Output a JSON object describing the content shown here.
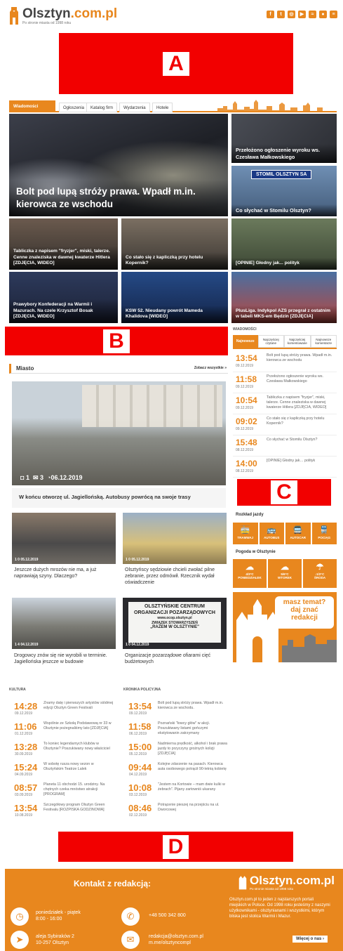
{
  "header": {
    "logo_main": "Olsztyn",
    "logo_domain": ".com.pl",
    "tagline": "Po stronie miasta od 1998 roku",
    "social": [
      {
        "icon": "facebook-icon",
        "glyph": "f"
      },
      {
        "icon": "twitter-icon",
        "glyph": "t"
      },
      {
        "icon": "instagram-icon",
        "glyph": "◎"
      },
      {
        "icon": "youtube-icon",
        "glyph": "▶"
      },
      {
        "icon": "rss-icon",
        "glyph": "≈"
      },
      {
        "icon": "user-icon",
        "glyph": "●"
      },
      {
        "icon": "menu-icon",
        "glyph": "≡"
      }
    ]
  },
  "ads": {
    "a": "A",
    "b": "B",
    "c": "C",
    "d": "D"
  },
  "nav": {
    "tabs": [
      "Wiadomości",
      "Ogłoszenia",
      "Katalog firm",
      "Wydarzenia",
      "Hotele"
    ]
  },
  "hero": {
    "main": "Bolt pod lupą stróży prawa. Wpadł m.in. kierowca ze wschodu",
    "side": [
      "Przełożono ogłoszenie wyroku ws. Czesława Małkowskiego",
      "Co słychać w Stomilu Olsztyn?"
    ],
    "sign": "STOMIL OLSZTYN SA",
    "row2": [
      "Tabliczka z napisem \"fryzjer\", miski, talerze. Cenne znaleziska w dawnej kwaterze Hitlera [ZDJĘCIA, WIDEO]",
      "Co stało się z kapliczką przy hotelu Kopernik?",
      "[OPINIE] Głodny jak... polityk"
    ],
    "row3": [
      "Prawybory Konfederacji na Warmii i Mazurach. Na czele Krzysztof Bosak [ZDJĘCIA, WIDEO]",
      "KSW 52. Nieudany powrót Mameda Khalidova [WIDEO]",
      "PlusLiga. Indykpol AZS przegrał z ostatnim w tabeli MKS-em Będzin [ZDJĘCIA]"
    ]
  },
  "latest": {
    "title": "WIADOMOŚCI",
    "tabs": [
      "Najnowsze",
      "Najczęściej czytane",
      "Najczęściej komentowane",
      "Najnowsze komentarze"
    ],
    "items": [
      {
        "time": "13:54",
        "date": "09.12.2019",
        "text": "Bolt pod lupą stróży prawa. Wpadł m.in. kierowca ze wschodu"
      },
      {
        "time": "11:58",
        "date": "09.12.2019",
        "text": "Przełożono ogłoszenie wyroku ws. Czesława Małkowskiego"
      },
      {
        "time": "10:54",
        "date": "09.12.2019",
        "text": "Tabliczka z napisem \"fryzjer\", miski, talerze. Cenne znaleziska w dawnej kwaterze Hitlera [ZDJĘCIA, WIDEO]"
      },
      {
        "time": "09:02",
        "date": "09.12.2019",
        "text": "Co stało się z kapliczką przy hotelu Kopernik?"
      },
      {
        "time": "15:48",
        "date": "08.12.2019",
        "text": "Co słychać w Stomilu Olsztyn?"
      },
      {
        "time": "14:00",
        "date": "08.12.2019",
        "text": "[OPINIE] Głodny jak… polityk"
      }
    ]
  },
  "city": {
    "title": "Miasto",
    "more": "Zobacz wszystkie »",
    "main": {
      "title": "W końcu otworzę ul. Jagiellońską. Autobusy powrócą na swoje trasy",
      "photos": "1",
      "comments": "3",
      "date": "06.12.2019"
    },
    "cards": [
      {
        "title": "Jeszcze dużych mrozów nie ma, a już naprawiają szyny. Dlaczego?",
        "meta": "1  0  05.12.2019"
      },
      {
        "title": "Olsztyńscy sędziowie chcieli zwołać pilne zebranie, przez odmówił. Rzecznik wydał oświadczenie",
        "meta": "1  0  05.12.2019"
      },
      {
        "title": "Drogowcy znów się nie wyrobili w terminie. Jagiellońska jeszcze w budowie",
        "meta": "1  4  04.12.2019"
      },
      {
        "title": "Organizacje pozarządowe ofiarami cięć budżetowych",
        "meta": "1  0  04.12.2019"
      }
    ],
    "sign": [
      "OLSZTYŃSKIE CENTRUM",
      "ORGANIZACJI POZARZĄDOWYCH",
      "www.ocop.olsztyn.pl",
      "ZWIĄZEK STOWARZYSZEŃ",
      "„RAZEM W OLSZTYNIE\""
    ]
  },
  "transport": {
    "title": "Rozkład jazdy",
    "items": [
      "TRAMWAJ",
      "AUTOBUS",
      "AUTOCAR",
      "POCIĄG"
    ]
  },
  "weather": {
    "title": "Pogoda w Olsztynie",
    "items": [
      {
        "temp": "4/3°C",
        "day": "PONIEDZIAŁEK"
      },
      {
        "temp": "5/6°C",
        "day": "WTOREK"
      },
      {
        "temp": "-1/2°C",
        "day": "ŚRODA"
      }
    ]
  },
  "promo": {
    "line1": "masz temat?",
    "line2": "daj znać",
    "line3": "redakcji"
  },
  "culture": {
    "title": "KULTURA",
    "items": [
      {
        "time": "14:28",
        "date": "09.12.2019",
        "text": "Znamy datę i pierwszych artystów siódmej edycji Olsztyn Green Festivali"
      },
      {
        "time": "11:06",
        "date": "01.12.2019",
        "text": "Wspólnie ze Szkołą Podstawową nr 33 w Olsztynie pożegnaliśmy lato [ZDJĘCIA]"
      },
      {
        "time": "13:28",
        "date": "30.09.2019",
        "text": "To koniec legendarnych klubów w Olsztynie? Poszukiwany nowy właściciel"
      },
      {
        "time": "15:24",
        "date": "04.09.2019",
        "text": "W sobotę rusza nowy sezon w Olsztyńskim Teatrze Lalek"
      },
      {
        "time": "08:57",
        "date": "03.09.2019",
        "text": "Planeta 11 obchodzi 15. urodziny. Na chętnych czeka mnóstwo atrakcji [PROGRAM]"
      },
      {
        "time": "13:54",
        "date": "10.08.2019",
        "text": "Szczegółowy program Olsztyn Green Festivalu [ROZPISKA GODZINOWA]"
      }
    ]
  },
  "police": {
    "title": "KRONIKA POLICYJNA",
    "items": [
      {
        "time": "13:54",
        "date": "09.12.2019",
        "text": "Bolt pod lupą stróży prawa. Wpadł m.in. kierowca ze wschodu."
      },
      {
        "time": "11:58",
        "date": "06.12.2019",
        "text": "Poznański \"łowcy głów\" w akcji. Poszukiwany listami gończymi ekstytowanin zatrzymany"
      },
      {
        "time": "15:00",
        "date": "05.12.2019",
        "text": "Nadmierna prędkość, alkohol i brak prawa jazdy to przyczyny grożnych kolizji [ZDJĘCIA]"
      },
      {
        "time": "09:44",
        "date": "04.12.2019",
        "text": "Kolejne zdarzenie na pasach. Kierowca auta osobowego potrącił 90-letnią kobietę"
      },
      {
        "time": "10:08",
        "date": "03.12.2019",
        "text": "\"Jestem na Kortowie – mam dwie kulki w żebrach\". Pijany zartowniś ukarany"
      },
      {
        "time": "08:46",
        "date": "02.12.2019",
        "text": "Potrącenie pieszej na przejściu na ul. Dworcowej"
      }
    ]
  },
  "footer": {
    "title": "Kontakt z redakcją:",
    "hours_label": "poniedziałek - piątek",
    "hours": "8:00 - 16:00",
    "phone": "+48 500 342 800",
    "address1": "aleja Sybiraków 2",
    "address2": "10-257 Olsztyn",
    "email": "redakcja@olsztyn.com.pl",
    "messenger": "m.me/olsztyncompl",
    "logo_main": "Olsztyn",
    "logo_domain": ".com.pl",
    "tagline": "Po stronie miasta od 1998 roku",
    "about": "Olsztyn.com.pl to jeden z najstarszych portali miejskich w Polsce. Od 1998 roku jesteśmy z naszymi użytkownikami - olsztynianami i wszystkimi, którym bliska jest stolica Warmii i Mazur.",
    "more": "Więcej o nas ›"
  },
  "colors": {
    "accent": "#e8871e",
    "ad": "#f20000"
  }
}
